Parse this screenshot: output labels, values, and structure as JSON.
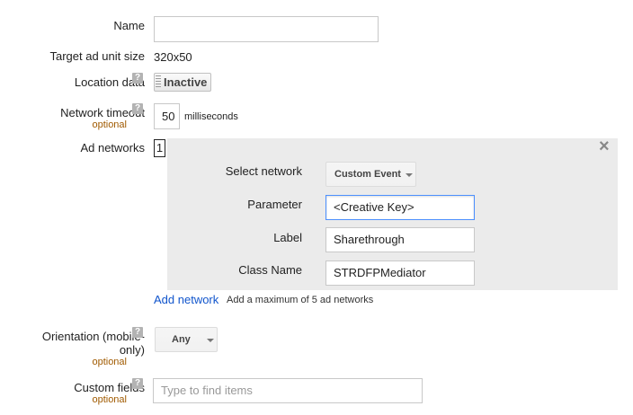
{
  "form": {
    "name": {
      "label": "Name",
      "value": ""
    },
    "target_size": {
      "label": "Target ad unit size",
      "value": "320x50"
    },
    "location": {
      "label": "Location data",
      "help": "?",
      "toggle_label": "Inactive"
    },
    "timeout": {
      "label": "Network timeout",
      "help": "?",
      "optional": "optional",
      "value": "50",
      "unit": "milliseconds"
    },
    "ad_networks": {
      "label": "Ad networks",
      "count": "1",
      "close": "×",
      "select_network": {
        "label": "Select network",
        "value": "Custom Event"
      },
      "parameter": {
        "label": "Parameter",
        "value": "<Creative Key>"
      },
      "label_field": {
        "label": "Label",
        "value": "Sharethrough"
      },
      "class_name": {
        "label": "Class Name",
        "value": "STRDFPMediator"
      },
      "add_network": "Add network",
      "max_note": "Add a maximum of 5 ad networks"
    },
    "orientation": {
      "label_line1": "Orientation (mobile-",
      "label_line2": "only)",
      "help": "?",
      "optional": "optional",
      "value": "Any"
    },
    "custom_fields": {
      "label": "Custom fields",
      "help": "?",
      "optional": "optional",
      "placeholder": "Type to find items"
    }
  },
  "colors": {
    "link": "#1155cc",
    "optional": "#a05a00",
    "panel": "#ebebeb",
    "focus": "#4d90fe"
  },
  "icons": {
    "help": "help-icon",
    "close": "close-icon",
    "dropdown": "chevron-down-icon",
    "grip": "grip-icon"
  }
}
